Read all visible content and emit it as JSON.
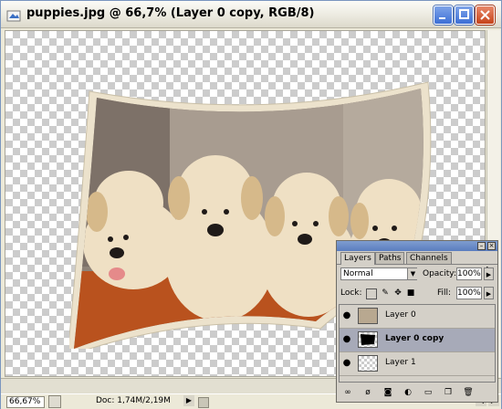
{
  "window": {
    "title": "puppies.jpg @ 66,7% (Layer 0 copy, RGB/8)",
    "controls": [
      "minimize",
      "maximize",
      "close"
    ]
  },
  "status": {
    "zoom": "66,67%",
    "doc_info": "Doc: 1,74M/2,19M"
  },
  "layers_panel": {
    "tabs": [
      {
        "label": "Layers",
        "active": true
      },
      {
        "label": "Paths",
        "active": false
      },
      {
        "label": "Channels",
        "active": false
      }
    ],
    "blend_mode": "Normal",
    "opacity_label": "Opacity:",
    "opacity_value": "100%",
    "lock_label": "Lock:",
    "fill_label": "Fill:",
    "fill_value": "100%",
    "layers": [
      {
        "name": "Layer 0",
        "visible": true,
        "selected": false,
        "thumb": "puppies"
      },
      {
        "name": "Layer 0 copy",
        "visible": true,
        "selected": true,
        "thumb": "black-shape"
      },
      {
        "name": "Layer 1",
        "visible": true,
        "selected": false,
        "thumb": "transparent"
      }
    ],
    "bottom_icons": [
      "link-icon",
      "layer-style-icon",
      "mask-icon",
      "adjustment-icon",
      "group-icon",
      "new-layer-icon",
      "trash-icon"
    ]
  },
  "colors": {
    "selection": "#a7aab8",
    "titlebar_close": "#c64319",
    "titlebar_buttons": "#3c6fd6"
  }
}
